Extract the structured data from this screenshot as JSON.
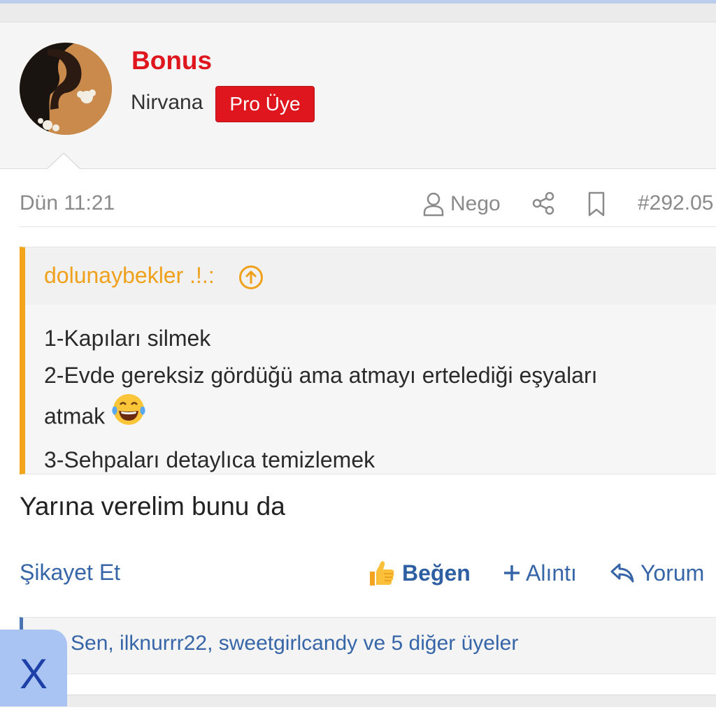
{
  "user": {
    "name": "Bonus",
    "title": "Nirvana",
    "badge": "Pro Üye"
  },
  "post": {
    "date": "Dün 11:21",
    "author_link": "Nego",
    "number": "#292.05",
    "text": "Yarına verelim bunu da"
  },
  "quote": {
    "author": "dolunaybekler .!.:",
    "lines": [
      "1-Kapıları silmek",
      "2-Evde gereksiz gördüğü ama atmayı ertelediği eşyaları",
      "atmak",
      "3-Sehpaları detaylıca temizlemek"
    ]
  },
  "actions": {
    "report": "Şikayet Et",
    "like": "Beğen",
    "quote": "Alıntı",
    "reply": "Yorum"
  },
  "likes": {
    "text": "Sen, ilknurrr22, sweetgirlcandy ve 5 diğer üyeler"
  },
  "overlay": {
    "close": "X"
  },
  "colors": {
    "username": "#e0161f",
    "badge": "#e0161f",
    "quote_accent": "#f2a51a",
    "link": "#3665a8"
  },
  "icons": [
    "user-icon",
    "share-icon",
    "bookmark-icon",
    "arrow-up-circle-icon",
    "tears-of-joy-emoji",
    "thumbs-up-icon",
    "plus-icon",
    "reply-icon"
  ]
}
